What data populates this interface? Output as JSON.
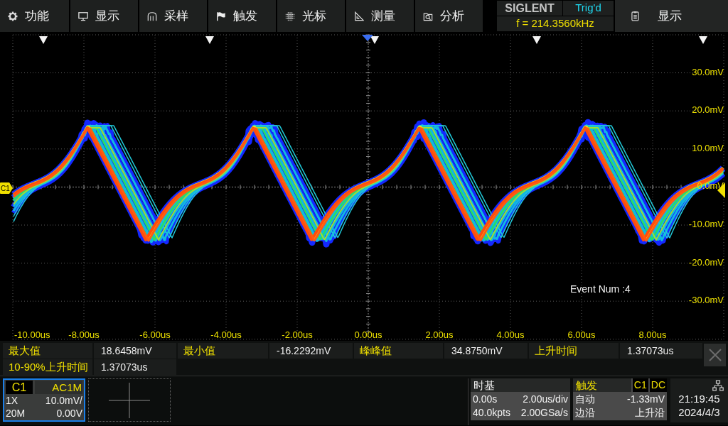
{
  "menu": [
    {
      "label": "功能"
    },
    {
      "label": "显示"
    },
    {
      "label": "采样"
    },
    {
      "label": "触发"
    },
    {
      "label": "光标"
    },
    {
      "label": "测量"
    },
    {
      "label": "分析"
    }
  ],
  "status": {
    "brand": "SIGLENT",
    "trigger_state": "Trig'd",
    "frequency": "f = 214.3560kHz"
  },
  "side_button": {
    "label": "显示"
  },
  "display": {
    "channel_marker": "C1",
    "event_text": "Event Num :4",
    "time_labels": [
      "-10.00us",
      "-8.00us",
      "-6.00us",
      "-4.00us",
      "-2.00us",
      "0.00us",
      "2.00us",
      "4.00us",
      "6.00us",
      "8.00us"
    ],
    "voltage_labels": [
      "30.0mV",
      "20.0mV",
      "10.0mV",
      "0.0mV",
      "-10.0mV",
      "-20.0mV",
      "-30.0mV"
    ]
  },
  "measurements": [
    {
      "label": "最大值",
      "value": "18.6458mV"
    },
    {
      "label": "最小值",
      "value": "-16.2292mV"
    },
    {
      "label": "峰峰值",
      "value": "34.8750mV"
    },
    {
      "label": "上升时间",
      "value": "1.37073us"
    },
    {
      "label": "10-90%上升时间",
      "value": "1.37073us"
    }
  ],
  "channel": {
    "name": "C1",
    "coupling": "AC1M",
    "probe": "1X",
    "scale": "10.0mV/",
    "bandwidth": "20M",
    "offset": "0.00V",
    "selected": true
  },
  "timebase": {
    "title": "时基",
    "delay": "0.00s",
    "scale": "2.00us/div",
    "memory_depth": "40.0kpts",
    "sample_rate": "2.00GSa/s"
  },
  "trigger": {
    "title": "触发",
    "source": "C1",
    "coupling": "DC",
    "mode": "自动",
    "trigger_level": "-1.33mV",
    "trigger_type": "边沿",
    "slope": "上升沿"
  },
  "clock": {
    "time": "21:19:45",
    "date": "2024/4/3"
  }
}
